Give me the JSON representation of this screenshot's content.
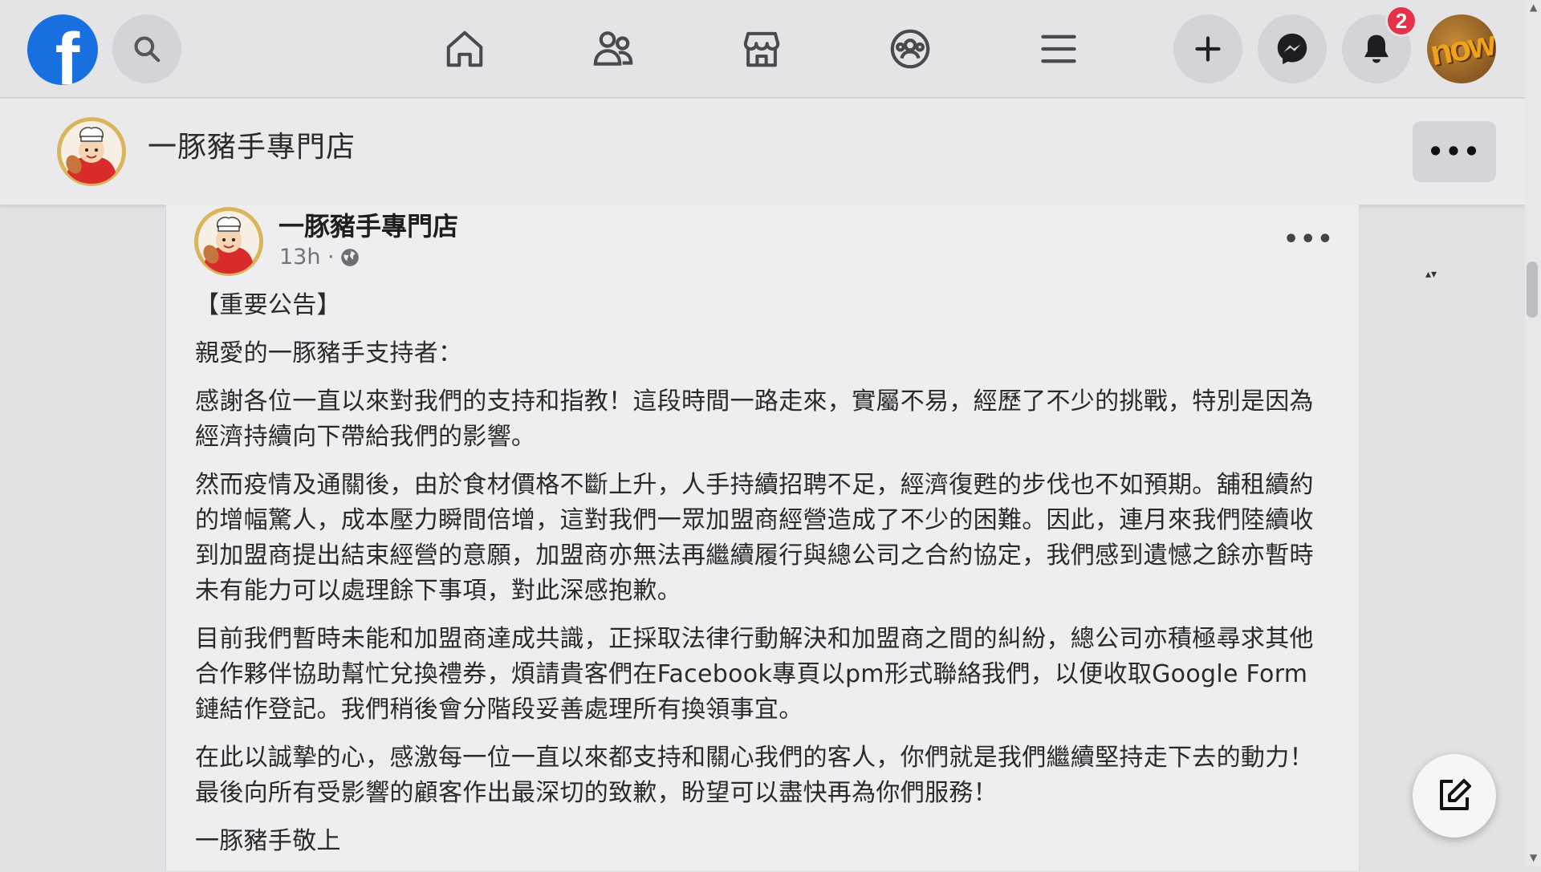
{
  "nav": {
    "logo_letter": "f",
    "notification_count": "2",
    "profile_text": "now",
    "icons": [
      "search-icon",
      "home-icon",
      "friends-icon",
      "marketplace-icon",
      "groups-icon",
      "menu-icon",
      "plus-icon",
      "messenger-icon",
      "bell-icon"
    ]
  },
  "page_header": {
    "name": "一豚豬手專門店",
    "more_label": "•••"
  },
  "post": {
    "author": "一豚豬手專門店",
    "time": "13h ·",
    "more_label": "•••",
    "paragraphs": [
      "【重要公告】",
      "親愛的一豚豬手支持者：",
      "感謝各位一直以來對我們的支持和指教！這段時間一路走來，實屬不易，經歷了不少的挑戰，特別是因為經濟持續向下帶給我們的影響。",
      "然而疫情及通關後，由於食材價格不斷上升，人手持續招聘不足，經濟復甦的步伐也不如預期。舖租續約的增幅驚人，成本壓力瞬間倍增，這對我們一眾加盟商經營造成了不少的困難。因此，連月來我們陸續收到加盟商提出結束經營的意願，加盟商亦無法再繼續履行與總公司之合約協定，我們感到遺憾之餘亦暫時未有能力可以處理餘下事項，對此深感抱歉。",
      "目前我們暫時未能和加盟商達成共識，正採取法律行動解決和加盟商之間的糾紛，總公司亦積極尋求其他合作夥伴協助幫忙兌換禮券，煩請貴客們在Facebook專頁以pm形式聯絡我們，以便收取Google Form 鏈結作登記。我們稍後會分階段妥善處理所有換領事宜。",
      "在此以誠摯的心，感激每一位一直以來都支持和關心我們的客人，你們就是我們繼續堅持走下去的動力！最後向所有受影響的顧客作出最深切的致歉，盼望可以盡快再為你們服務！",
      "一豚豬手敬上"
    ]
  },
  "colors": {
    "brand": "#1870e0",
    "badge": "#e53248",
    "background": "#e2e1e3"
  }
}
